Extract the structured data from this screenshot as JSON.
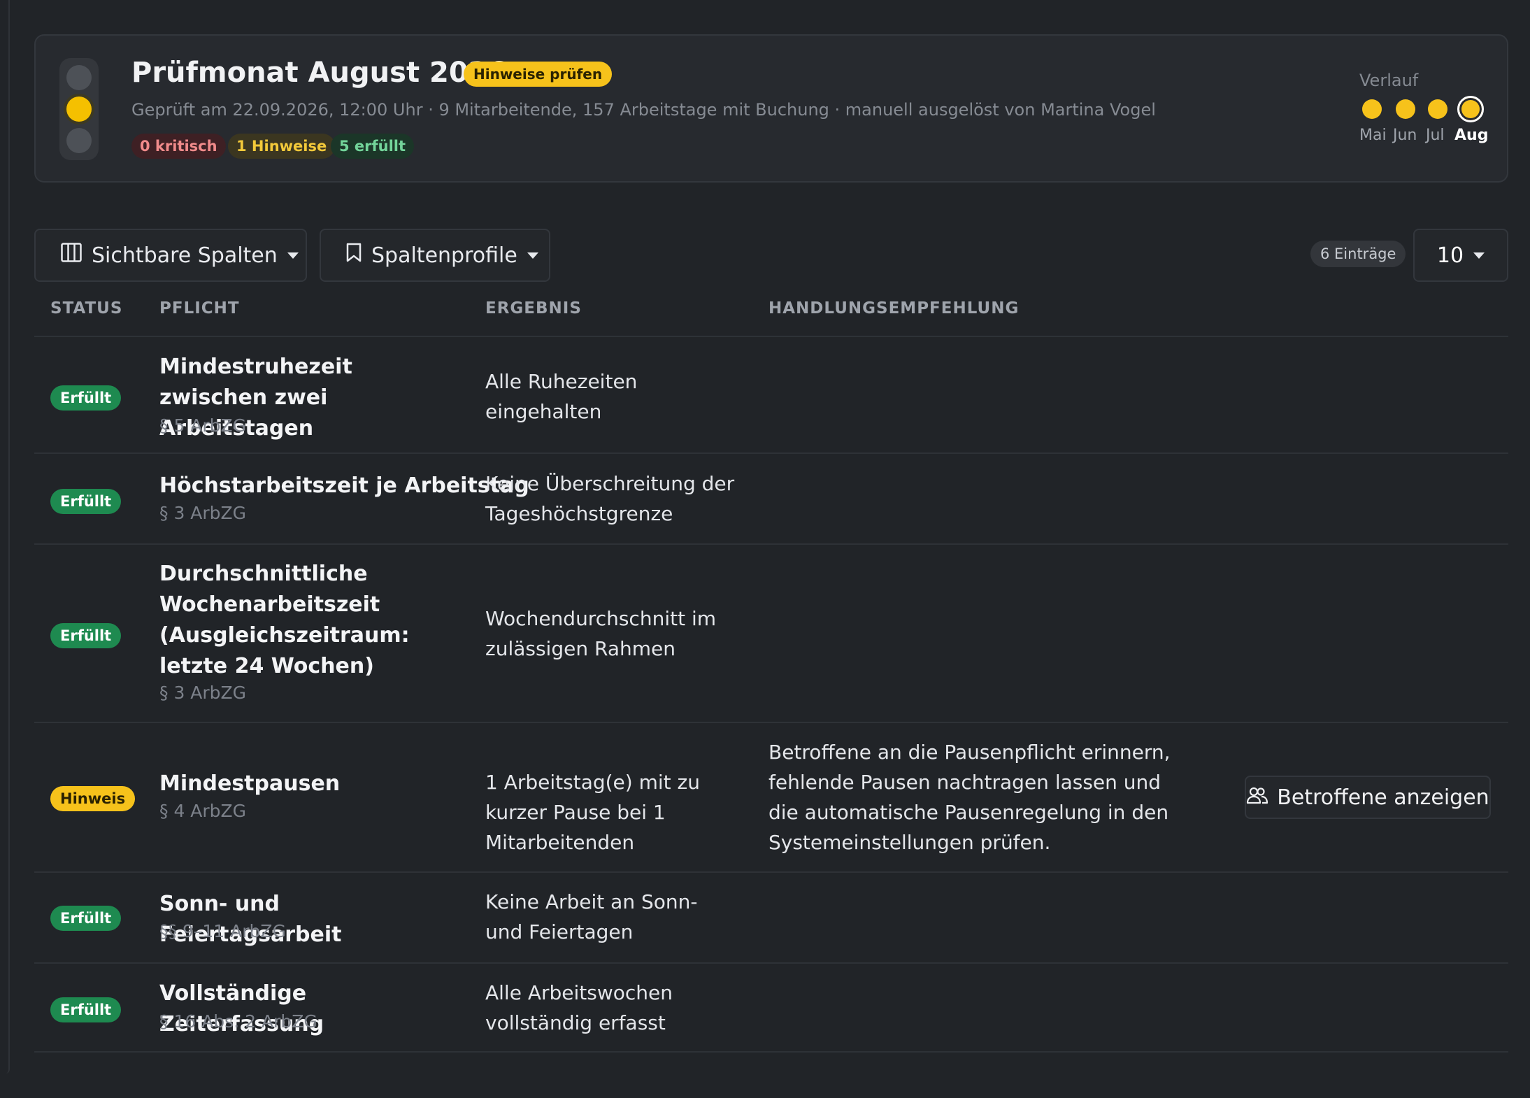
{
  "summary": {
    "title": "Prüfmonat August 2026",
    "status_badge": "Hinweise prüfen",
    "meta": "Geprüft am 22.09.2026, 12:00 Uhr · 9 Mitarbeitende, 157 Arbeitstage mit Buchung · manuell ausgelöst von Martina Vogel",
    "counts": {
      "critical": "0 kritisch",
      "hints": "1 Hinweise",
      "fulfilled": "5 erfüllt"
    },
    "traffic_light_state": "yellow",
    "history": {
      "label": "Verlauf",
      "months": [
        {
          "label": "Mai",
          "state": "yellow"
        },
        {
          "label": "Jun",
          "state": "yellow"
        },
        {
          "label": "Jul",
          "state": "yellow"
        },
        {
          "label": "Aug",
          "state": "yellow",
          "current": true
        }
      ]
    }
  },
  "toolbar": {
    "visible_columns_label": "Sichtbare Spalten",
    "column_profiles_label": "Spaltenprofile",
    "entries_count": "6 Einträge",
    "page_size": "10"
  },
  "table": {
    "headers": {
      "status": "STATUS",
      "pflicht": "PFLICHT",
      "ergebnis": "ERGEBNIS",
      "handlung": "HANDLUNGSEMPFEHLUNG"
    },
    "rows": [
      {
        "status": "Erfüllt",
        "status_type": "ok",
        "title": "Mindestruhezeit zwischen zwei Arbeitstagen",
        "law": "§ 5 ArbZG",
        "result": "Alle Ruhezeiten eingehalten",
        "recommendation": ""
      },
      {
        "status": "Erfüllt",
        "status_type": "ok",
        "title": "Höchstarbeitszeit je Arbeitstag",
        "law": "§ 3 ArbZG",
        "result": "Keine Überschreitung der Tageshöchstgrenze",
        "recommendation": ""
      },
      {
        "status": "Erfüllt",
        "status_type": "ok",
        "title": "Durchschnittliche Wochenarbeitszeit (Ausgleichszeitraum: letzte 24 Wochen)",
        "law": "§ 3 ArbZG",
        "result": "Wochendurchschnitt im zulässigen Rahmen",
        "recommendation": ""
      },
      {
        "status": "Hinweis",
        "status_type": "hint",
        "title": "Mindestpausen",
        "law": "§ 4 ArbZG",
        "result": "1 Arbeitstag(e) mit zu kurzer Pause bei 1 Mitarbeitenden",
        "recommendation": "Betroffene an die Pausenpflicht erinnern, fehlende Pausen nachtragen lassen und die automatische Pausenregelung in den Systemeinstellungen prüfen.",
        "action_label": "Betroffene anzeigen"
      },
      {
        "status": "Erfüllt",
        "status_type": "ok",
        "title": "Sonn- und Feiertagsarbeit",
        "law": "§§ 9–11 ArbZG",
        "result": "Keine Arbeit an Sonn- und Feiertagen",
        "recommendation": ""
      },
      {
        "status": "Erfüllt",
        "status_type": "ok",
        "title": "Vollständige Zeiterfassung",
        "law": "§ 16 Abs. 2 ArbZG",
        "result": "Alle Arbeitswochen vollständig erfasst",
        "recommendation": ""
      }
    ]
  },
  "colors": {
    "accent_yellow": "#f6c21b",
    "success_green": "#1e8a50",
    "critical_red": "#f08b8b",
    "background": "#212428"
  }
}
